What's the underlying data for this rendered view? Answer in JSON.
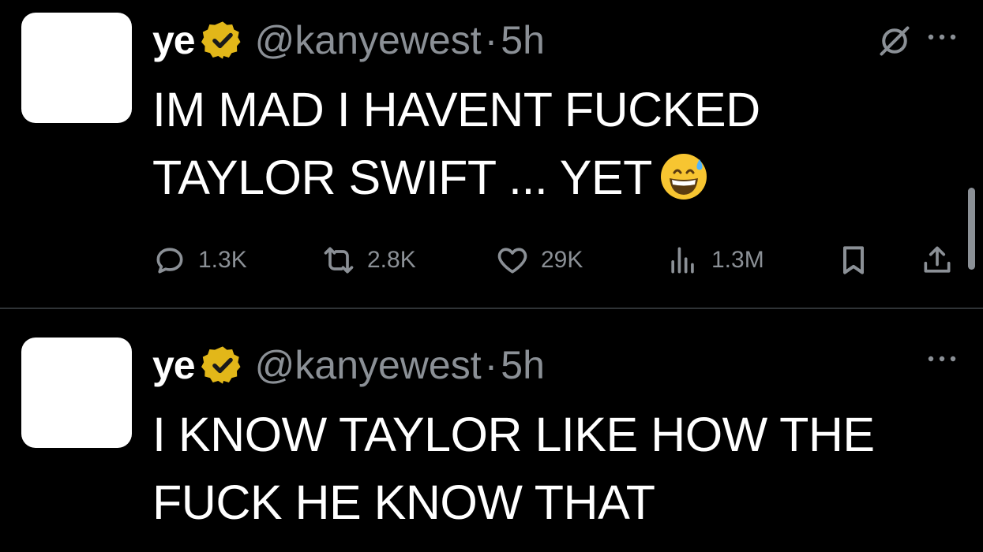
{
  "tweets": [
    {
      "name": "ye",
      "handle": "@kanyewest",
      "separator": "·",
      "time": "5h",
      "text_line1": "IM MAD I HAVENT FUCKED",
      "text_line2": "TAYLOR SWIFT ... YET",
      "emoji": "grinning-face-with-sweat",
      "stats": {
        "replies": "1.3K",
        "reposts": "2.8K",
        "likes": "29K",
        "views": "1.3M"
      }
    },
    {
      "name": "ye",
      "handle": "@kanyewest",
      "separator": "·",
      "time": "5h",
      "text_line1": "I KNOW TAYLOR LIKE HOW THE",
      "text_line2": "FUCK HE KNOW THAT"
    }
  ],
  "icons": {
    "verified": "verified-badge-icon",
    "grok": "grok-icon",
    "more": "more-icon",
    "reply": "reply-icon",
    "repost": "repost-icon",
    "like": "heart-icon",
    "views": "views-icon",
    "bookmark": "bookmark-icon",
    "share": "share-icon"
  },
  "colors": {
    "background": "#000000",
    "text": "#ffffff",
    "secondary": "#8b9096",
    "verified_gold": "#e2b719",
    "divider": "#2f3336"
  }
}
